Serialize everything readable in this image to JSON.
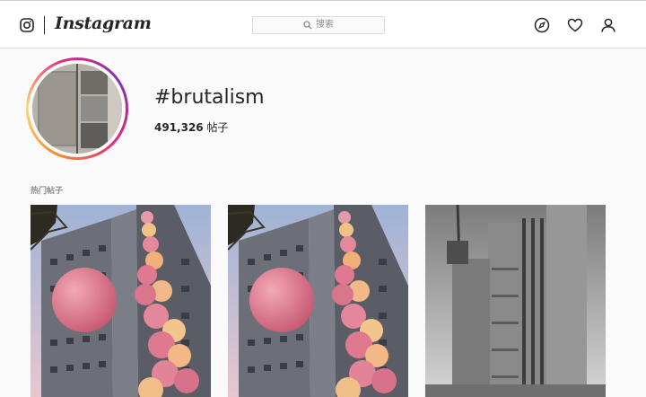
{
  "header": {
    "brand": "Instagram",
    "logo_icon": "camera-outline-icon",
    "search": {
      "placeholder": "搜索",
      "icon": "search-icon"
    },
    "nav_icons": [
      "compass-icon",
      "heart-icon",
      "user-icon"
    ]
  },
  "profile": {
    "hashtag": "#brutalism",
    "post_count": "491,326",
    "post_count_label": "帖子"
  },
  "section": {
    "top_posts_label": "热门帖子"
  },
  "posts": [
    {
      "kind": "tower-with-pink-spheres"
    },
    {
      "kind": "tower-with-pink-spheres"
    },
    {
      "kind": "grayscale-concrete-tower"
    }
  ],
  "colors": {
    "ring_gradient": [
      "#f58529",
      "#feda77",
      "#dd2a7b",
      "#8134af"
    ],
    "sphere_pink": "#e27a8c",
    "sky": "#b9c8e0"
  }
}
